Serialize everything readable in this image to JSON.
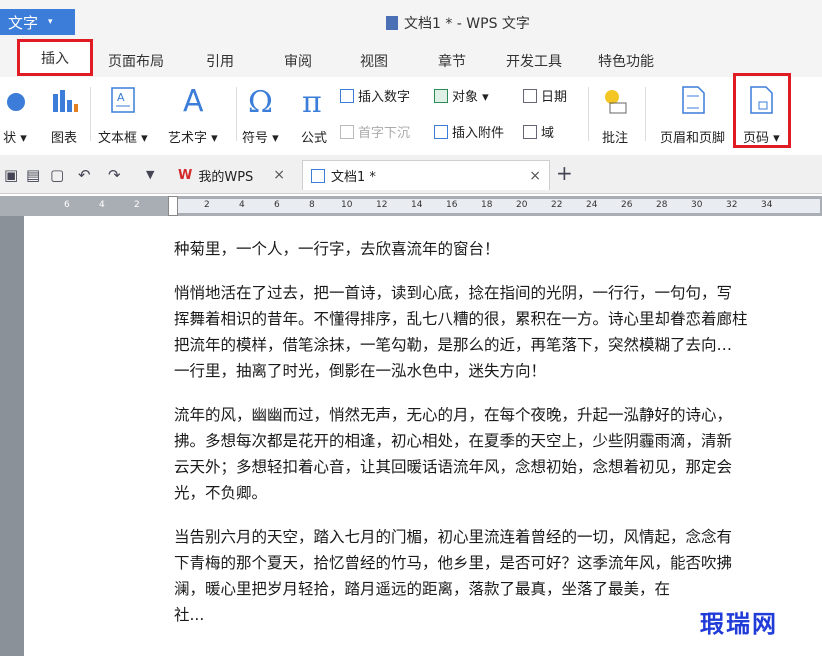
{
  "app": {
    "menu_label": "文字",
    "menu_arrow": "▾"
  },
  "window": {
    "title": "文档1 * - WPS 文字"
  },
  "ribbon_tabs": [
    {
      "label": "插入"
    },
    {
      "label": "页面布局"
    },
    {
      "label": "引用"
    },
    {
      "label": "审阅"
    },
    {
      "label": "视图"
    },
    {
      "label": "章节"
    },
    {
      "label": "开发工具"
    },
    {
      "label": "特色功能"
    }
  ],
  "ribbon": {
    "shape_label": "状 ▾",
    "chart_label": "图表",
    "textbox_label": "文本框 ▾",
    "wordart_label": "艺术字 ▾",
    "symbol_label": "符号 ▾",
    "formula_label": "公式",
    "insert_number": "插入数字",
    "object": "对象 ▾",
    "date": "日期",
    "dropcap": "首字下沉",
    "attachment": "插入附件",
    "field": "域",
    "comment_label": "批注",
    "header_footer_label": "页眉和页脚",
    "page_number_label": "页码 ▾"
  },
  "quickbar": {
    "tab1": "我的WPS",
    "tab2": "文档1 *",
    "close": "×",
    "add": "+"
  },
  "ruler": {
    "left_ticks": [
      "6",
      "4",
      "2"
    ],
    "right_ticks": [
      "2",
      "4",
      "6",
      "8",
      "10",
      "12",
      "14",
      "16",
      "18",
      "20",
      "22",
      "24",
      "26",
      "28",
      "30",
      "32",
      "34"
    ]
  },
  "document": {
    "paragraphs": [
      {
        "lines": [
          "种菊里，一个人，一行字，去欣喜流年的窗台！"
        ]
      },
      {
        "lines": [
          "悄悄地活在了过去，把一首诗，读到心底，捻在指间的光阴，一行行，一句句，写",
          "挥舞着相识的昔年。不懂得排序，乱七八糟的很，累积在一方。诗心里却眷恋着廊柱",
          "把流年的模样，借笔涂抹，一笔勾勒，是那么的近，再笔落下，突然模糊了去向…",
          "一行里，抽离了时光，倒影在一泓水色中，迷失方向！"
        ]
      },
      {
        "lines": [
          "流年的风，幽幽而过，悄然无声，无心的月，在每个夜晚，升起一泓静好的诗心，",
          "拂。多想每次都是花开的相逢，初心相处，在夏季的天空上，少些阴霾雨滴，清新",
          "云天外；多想轻扣着心音，让其回暖话语流年风，念想初始，念想着初见，那定会",
          "光，不负卿。"
        ]
      },
      {
        "lines": [
          "当告别六月的天空，踏入七月的门楣，初心里流连着曾经的一切，风情起，念念有",
          "下青梅的那个夏天，拾忆曾经的竹马，他乡里，是否可好？这季流年风，能否吹拂",
          "澜，暖心里把岁月轻拾，踏月遥远的距离，落款了最真，坐落了最美，在",
          "社..."
        ]
      }
    ]
  },
  "watermark": "瑕瑞网"
}
